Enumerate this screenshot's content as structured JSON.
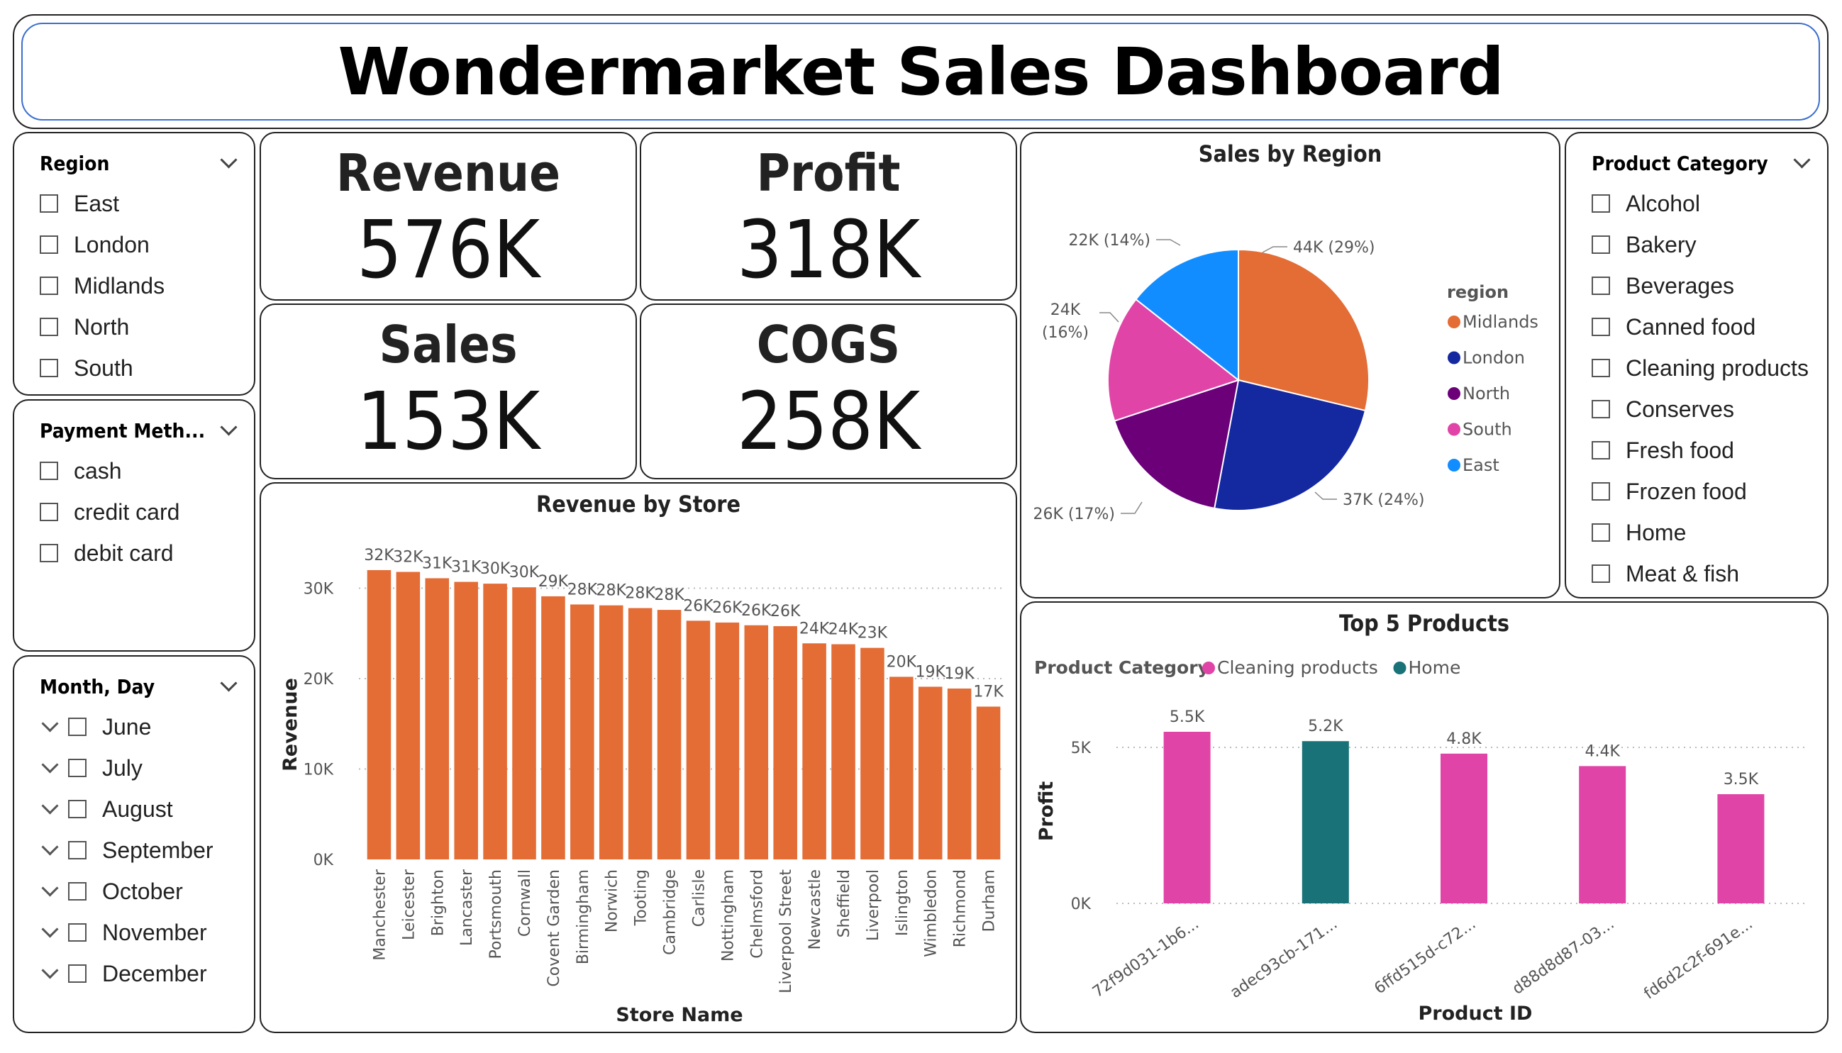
{
  "title": "Wondermarket Sales Dashboard",
  "slicers": {
    "region": {
      "title": "Region",
      "options": [
        "East",
        "London",
        "Midlands",
        "North",
        "South"
      ]
    },
    "payment": {
      "title": "Payment Meth...",
      "options": [
        "cash",
        "credit card",
        "debit card"
      ]
    },
    "month": {
      "title": "Month, Day",
      "options": [
        "June",
        "July",
        "August",
        "September",
        "October",
        "November",
        "December"
      ]
    },
    "category": {
      "title": "Product Category",
      "options": [
        "Alcohol",
        "Bakery",
        "Beverages",
        "Canned food",
        "Cleaning products",
        "Conserves",
        "Fresh food",
        "Frozen food",
        "Home",
        "Meat & fish"
      ]
    }
  },
  "kpis": {
    "revenue": {
      "label": "Revenue",
      "value": "576K"
    },
    "profit": {
      "label": "Profit",
      "value": "318K"
    },
    "sales": {
      "label": "Sales",
      "value": "153K"
    },
    "cogs": {
      "label": "COGS",
      "value": "258K"
    }
  },
  "colors": {
    "bar": "#E46C35",
    "midlands": "#E46C35",
    "london": "#1428A0",
    "north": "#6B0079",
    "south": "#E044A7",
    "east": "#118DFF",
    "cleaning": "#E044A7",
    "home": "#197278"
  },
  "chart_data": [
    {
      "type": "bar",
      "title": "Revenue by Store",
      "xlabel": "Store Name",
      "ylabel": "Revenue",
      "ylim": [
        0,
        32000
      ],
      "yticks": [
        "0K",
        "10K",
        "20K",
        "30K"
      ],
      "grid": true,
      "categories": [
        "Manchester",
        "Leicester",
        "Brighton",
        "Lancaster",
        "Portsmouth",
        "Cornwall",
        "Covent Garden",
        "Birmingham",
        "Norwich",
        "Tooting",
        "Cambridge",
        "Carlisle",
        "Nottingham",
        "Chelmsford",
        "Liverpool Street",
        "Newcastle",
        "Sheffield",
        "Liverpool",
        "Islington",
        "Wimbledon",
        "Richmond",
        "Durham"
      ],
      "values": [
        32000,
        31800,
        31100,
        30700,
        30500,
        30100,
        29100,
        28200,
        28100,
        27800,
        27600,
        26400,
        26200,
        25900,
        25800,
        23900,
        23800,
        23400,
        20200,
        19100,
        18900,
        16900
      ],
      "labels": [
        "32K",
        "32K",
        "31K",
        "31K",
        "30K",
        "30K",
        "29K",
        "28K",
        "28K",
        "28K",
        "28K",
        "26K",
        "26K",
        "26K",
        "26K",
        "24K",
        "24K",
        "23K",
        "20K",
        "19K",
        "19K",
        "17K"
      ]
    },
    {
      "type": "pie",
      "title": "Sales by Region",
      "legend_title": "region",
      "legend_position": "right",
      "slices": [
        {
          "name": "Midlands",
          "value": 44,
          "label": "44K (29%)"
        },
        {
          "name": "London",
          "value": 37,
          "label": "37K (24%)"
        },
        {
          "name": "North",
          "value": 26,
          "label": "26K (17%)"
        },
        {
          "name": "South",
          "value": 24,
          "label_lines": [
            "24K",
            "(16%)"
          ]
        },
        {
          "name": "East",
          "value": 22,
          "label": "22K (14%)"
        }
      ]
    },
    {
      "type": "bar",
      "title": "Top 5 Products",
      "xlabel": "Product ID",
      "ylabel": "Profit",
      "legend_title": "Product Category",
      "legend_position": "top-left",
      "series_names": [
        "Cleaning products",
        "Home"
      ],
      "yticks": [
        "0K",
        "5K"
      ],
      "grid": true,
      "categories": [
        "72f9d031-1b6...",
        "adec93cb-171...",
        "6ffd515d-c72...",
        "d88d8d87-03...",
        "fd6d2c2f-691e..."
      ],
      "bars": [
        {
          "category": "72f9d031-1b6...",
          "series": "Cleaning products",
          "value": 5500,
          "label": "5.5K"
        },
        {
          "category": "adec93cb-171...",
          "series": "Home",
          "value": 5200,
          "label": "5.2K"
        },
        {
          "category": "6ffd515d-c72...",
          "series": "Cleaning products",
          "value": 4800,
          "label": "4.8K"
        },
        {
          "category": "d88d8d87-03...",
          "series": "Cleaning products",
          "value": 4400,
          "label": "4.4K"
        },
        {
          "category": "fd6d2c2f-691e...",
          "series": "Cleaning products",
          "value": 3500,
          "label": "3.5K"
        }
      ]
    }
  ]
}
